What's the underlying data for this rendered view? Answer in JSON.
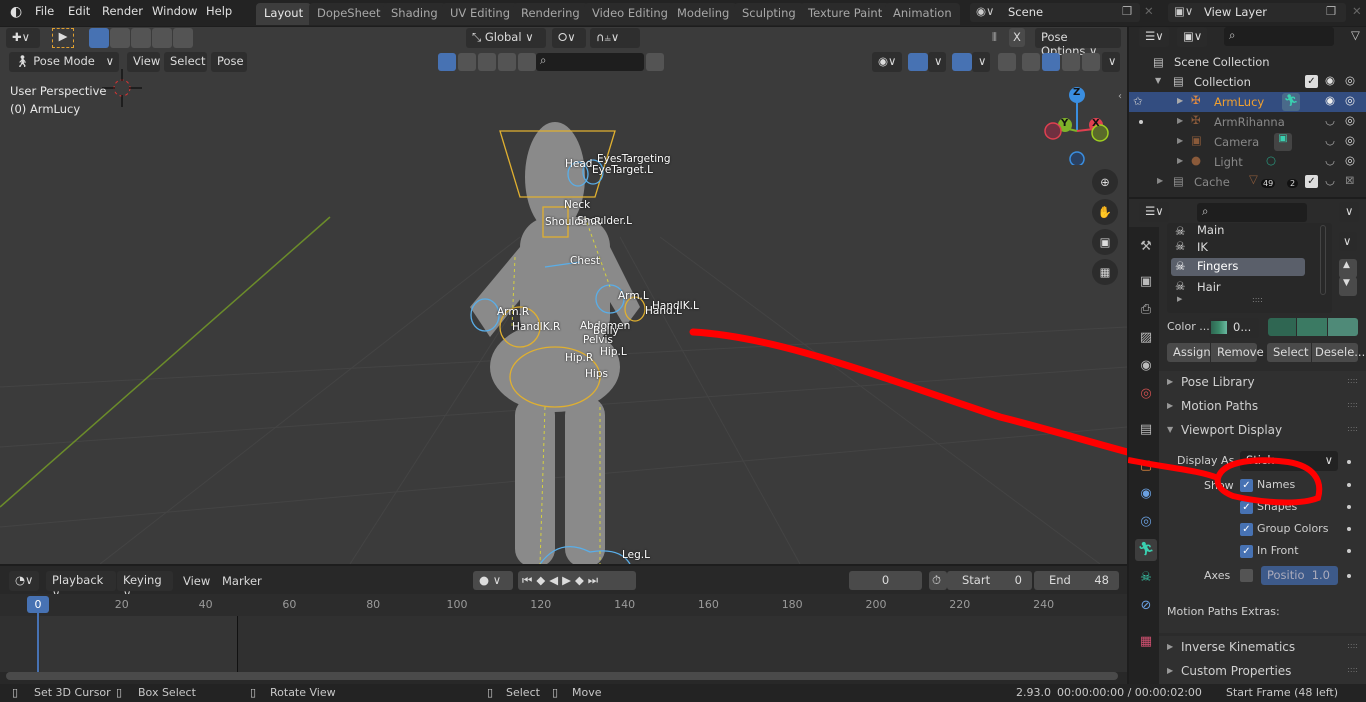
{
  "topbar": {
    "menus": [
      "File",
      "Edit",
      "Render",
      "Window",
      "Help"
    ],
    "workspaces": [
      "Layout",
      "DopeSheet",
      "Shading",
      "UV Editing",
      "Rendering",
      "Video Editing",
      "Modeling",
      "Sculpting",
      "Texture Paint",
      "Animation"
    ],
    "active_workspace": "Layout",
    "scene": "Scene",
    "view_layer": "View Layer"
  },
  "viewport": {
    "header": {
      "mode": "Pose Mode",
      "menus": [
        "View",
        "Select",
        "Pose"
      ],
      "orientation": "Global",
      "pose_options": "Pose Options",
      "x_mirror": "X"
    },
    "overlay_text": {
      "perspective": "User Perspective",
      "object": "(0) ArmLucy"
    },
    "gizmo_axes": [
      "Z",
      "Y",
      "X"
    ],
    "bone_labels": [
      {
        "name": "EyesTargeting"
      },
      {
        "name": "Head"
      },
      {
        "name": "EyeTarget.L"
      },
      {
        "name": "Neck"
      },
      {
        "name": "Shoulder.R"
      },
      {
        "name": "Shoulder.L"
      },
      {
        "name": "Chest"
      },
      {
        "name": "Arm.L"
      },
      {
        "name": "HandIK.L"
      },
      {
        "name": "Hand.L"
      },
      {
        "name": "Arm.R"
      },
      {
        "name": "HandIK.R"
      },
      {
        "name": "Abdomen"
      },
      {
        "name": "Belly"
      },
      {
        "name": "Pelvis"
      },
      {
        "name": "Hip.L"
      },
      {
        "name": "Hip.R"
      },
      {
        "name": "Hips"
      },
      {
        "name": "Leg.L"
      }
    ]
  },
  "timeline": {
    "menus": [
      "Playback",
      "Keying",
      "View",
      "Marker"
    ],
    "current_frame": "0",
    "start_label": "Start",
    "start": "0",
    "end_label": "End",
    "end": "48",
    "ticks": [
      "0",
      "20",
      "40",
      "60",
      "80",
      "100",
      "120",
      "140",
      "160",
      "180",
      "200",
      "220",
      "240"
    ]
  },
  "outliner": {
    "root": "Scene Collection",
    "items": [
      {
        "name": "Collection",
        "type": "collection"
      },
      {
        "name": "ArmLucy",
        "type": "armature",
        "selected": true
      },
      {
        "name": "ArmRihanna",
        "type": "armature"
      },
      {
        "name": "Camera",
        "type": "camera"
      },
      {
        "name": "Light",
        "type": "light"
      },
      {
        "name": "Cache",
        "type": "collection",
        "badges": [
          "49",
          "2"
        ]
      }
    ]
  },
  "properties": {
    "bone_groups": [
      "Main",
      "IK",
      "Fingers",
      "Hair"
    ],
    "active_group": "Fingers",
    "color_set_label": "Color ...",
    "color_set_value": "0...",
    "colors": [
      "#2f6652",
      "#3b7a63",
      "#4f8a78"
    ],
    "buttons": {
      "assign": "Assign",
      "remove": "Remove",
      "select": "Select",
      "deselect": "Desele..."
    },
    "panels": {
      "pose_library": "Pose Library",
      "motion_paths": "Motion Paths",
      "viewport_display": "Viewport Display",
      "inverse_kinematics": "Inverse Kinematics",
      "custom_properties": "Custom Properties"
    },
    "display_as_label": "Display As",
    "display_as_value": "Stick",
    "show_label": "Show",
    "show_options": [
      {
        "label": "Names",
        "checked": true
      },
      {
        "label": "Shapes",
        "checked": true
      },
      {
        "label": "Group Colors",
        "checked": true
      },
      {
        "label": "In Front",
        "checked": true
      }
    ],
    "axes_label": "Axes",
    "axes_checked": false,
    "position_label": "Positio",
    "position_value": "1.0",
    "motion_paths_extras": "Motion Paths Extras:"
  },
  "statusbar": {
    "hints": [
      "Set 3D Cursor",
      "Box Select",
      "Rotate View",
      "Select",
      "Move"
    ],
    "version": "2.93.0",
    "time": "00:00:00:00 / 00:00:02:00",
    "frame_info": "Start Frame (48 left)"
  },
  "annotation": {
    "color": "#ff0000"
  }
}
